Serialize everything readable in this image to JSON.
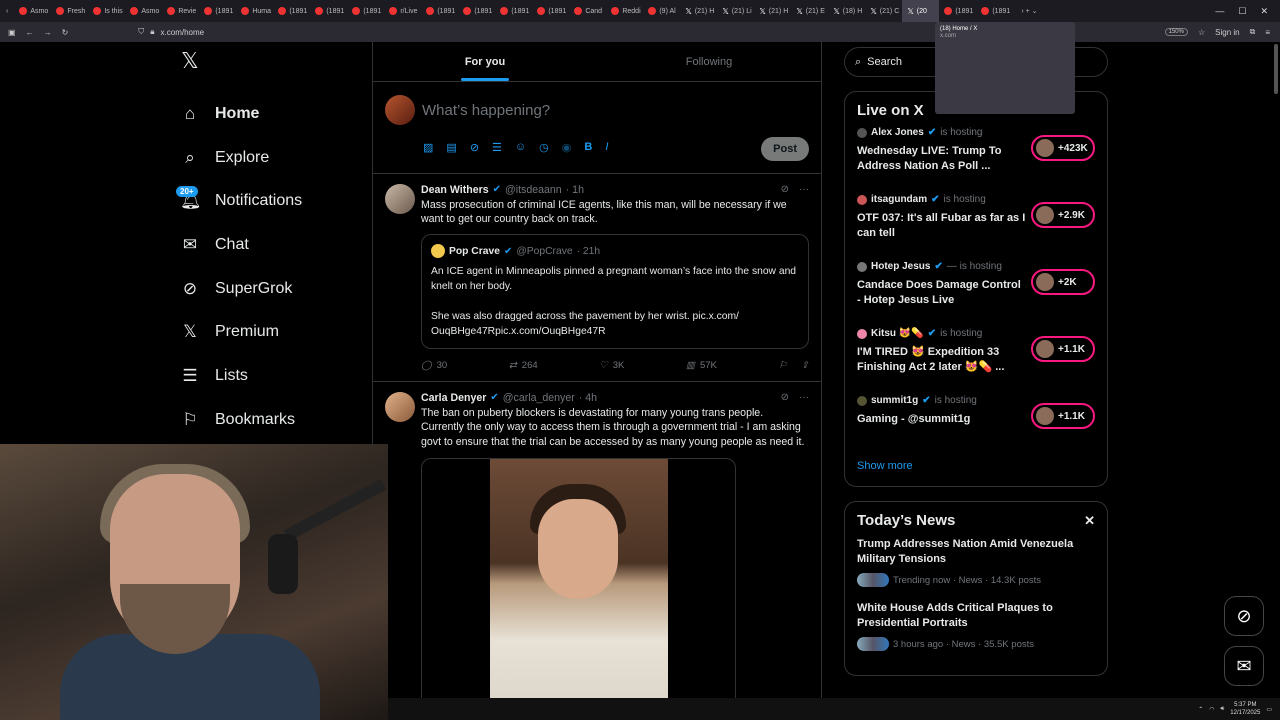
{
  "browser": {
    "tabs": [
      {
        "label": "Asmo",
        "icon": "circle"
      },
      {
        "label": "Fresh",
        "icon": "circle"
      },
      {
        "label": "Is this",
        "icon": "circle"
      },
      {
        "label": "Asmo",
        "icon": "circle"
      },
      {
        "label": "Revie",
        "icon": "circle"
      },
      {
        "label": "(1891",
        "icon": "circle"
      },
      {
        "label": "Huma",
        "icon": "circle"
      },
      {
        "label": "(1891",
        "icon": "circle"
      },
      {
        "label": "(1891",
        "icon": "circle"
      },
      {
        "label": "(1891",
        "icon": "circle"
      },
      {
        "label": "r/Live",
        "icon": "circle"
      },
      {
        "label": "(1891",
        "icon": "circle"
      },
      {
        "label": "(1891",
        "icon": "circle"
      },
      {
        "label": "(1891",
        "icon": "circle"
      },
      {
        "label": "(1891",
        "icon": "circle"
      },
      {
        "label": "Cand",
        "icon": "circle"
      },
      {
        "label": "Reddi",
        "icon": "circle"
      },
      {
        "label": "(9) Al",
        "icon": "circle"
      },
      {
        "label": "(21) H",
        "icon": "x"
      },
      {
        "label": "(21) Li",
        "icon": "x"
      },
      {
        "label": "(21) H",
        "icon": "x"
      },
      {
        "label": "(21) E",
        "icon": "x"
      },
      {
        "label": "(18) H",
        "icon": "x"
      },
      {
        "label": "(21) C",
        "icon": "x"
      },
      {
        "label": "(20",
        "icon": "x",
        "active": true
      },
      {
        "label": "(1891",
        "icon": "circle"
      },
      {
        "label": "(1891",
        "icon": "circle"
      }
    ],
    "url": "x.com/home",
    "zoom": "150%",
    "sign_in": "Sign in",
    "tooltip_title": "(18) Home / X",
    "tooltip_sub": "x.com"
  },
  "nav": {
    "items": [
      {
        "label": "Home",
        "icon": "home-icon"
      },
      {
        "label": "Explore",
        "icon": "search-icon"
      },
      {
        "label": "Notifications",
        "icon": "bell-icon",
        "badge": "20+"
      },
      {
        "label": "Chat",
        "icon": "mail-icon"
      },
      {
        "label": "SuperGrok",
        "icon": "grok-icon"
      },
      {
        "label": "Premium",
        "icon": "x-icon"
      },
      {
        "label": "Lists",
        "icon": "list-icon"
      },
      {
        "label": "Bookmarks",
        "icon": "bookmark-icon"
      }
    ]
  },
  "main": {
    "tab_for_you": "For you",
    "tab_following": "Following",
    "composer_placeholder": "What’s happening?",
    "post_button": "Post",
    "tweets": [
      {
        "name": "Dean Withers",
        "handle": "@itsdeaann",
        "time": "· 1h",
        "text": "Mass prosecution of criminal ICE agents, like this man, will be necessary if we want to get our country back on track.",
        "quote": {
          "name": "Pop Crave",
          "handle": "@PopCrave",
          "time": "· 21h",
          "text1": "An ICE agent in Minneapolis pinned a pregnant woman’s face into the snow and knelt on her body.",
          "text2": "She was also dragged across the pavement by her wrist. pic.x.com/\nOuqBHge47Rpic.x.com/OuqBHge47R"
        },
        "replies": "30",
        "reposts": "264",
        "likes": "3K",
        "views": "57K"
      },
      {
        "name": "Carla Denyer",
        "handle": "@carla_denyer",
        "time": "· 4h",
        "text": "The ban on puberty blockers is devastating for many young trans people. Currently the only way to access them is through a government trial - I am asking govt to ensure that the trial can be accessed by as many young people as need it."
      }
    ]
  },
  "right": {
    "search_placeholder": "Search",
    "live_title": "Live on X",
    "live_items": [
      {
        "host": "Alex Jones",
        "status": "is hosting",
        "title": "Wednesday LIVE: Trump To Address Nation As Poll ...",
        "count": "+423K"
      },
      {
        "host": "itsagundam",
        "status": "is hosting",
        "title": "OTF 037: It's all Fubar as far as I can tell",
        "count": "+2.9K"
      },
      {
        "host": "Hotep Jesus",
        "status": "— is hosting",
        "title": "Candace Does Damage Control - Hotep Jesus Live",
        "count": "+2K"
      },
      {
        "host": "Kitsu 😻💊",
        "status": "is hosting",
        "title": "I'M TIRED 😻 Expedition 33 Finishing Act 2 later 😻💊 ...",
        "count": "+1.1K"
      },
      {
        "host": "summit1g",
        "status": "is hosting",
        "title": "Gaming - @summit1g",
        "count": "+1.1K"
      }
    ],
    "show_more": "Show more",
    "news_title": "Today’s News",
    "news": [
      {
        "title": "Trump Addresses Nation Amid Venezuela Military Tensions",
        "meta": "Trending now · News · 14.3K posts"
      },
      {
        "title": "White House Adds Critical Plaques to Presidential Portraits",
        "meta": "3 hours ago · News · 35.5K posts"
      }
    ]
  },
  "taskbar": {
    "time": "5:37 PM",
    "date": "12/17/2025"
  },
  "colors": {
    "accent": "#1d9bf0",
    "live": "#f91880",
    "bg": "#000000",
    "border": "#2f3336",
    "muted": "#71767b"
  }
}
